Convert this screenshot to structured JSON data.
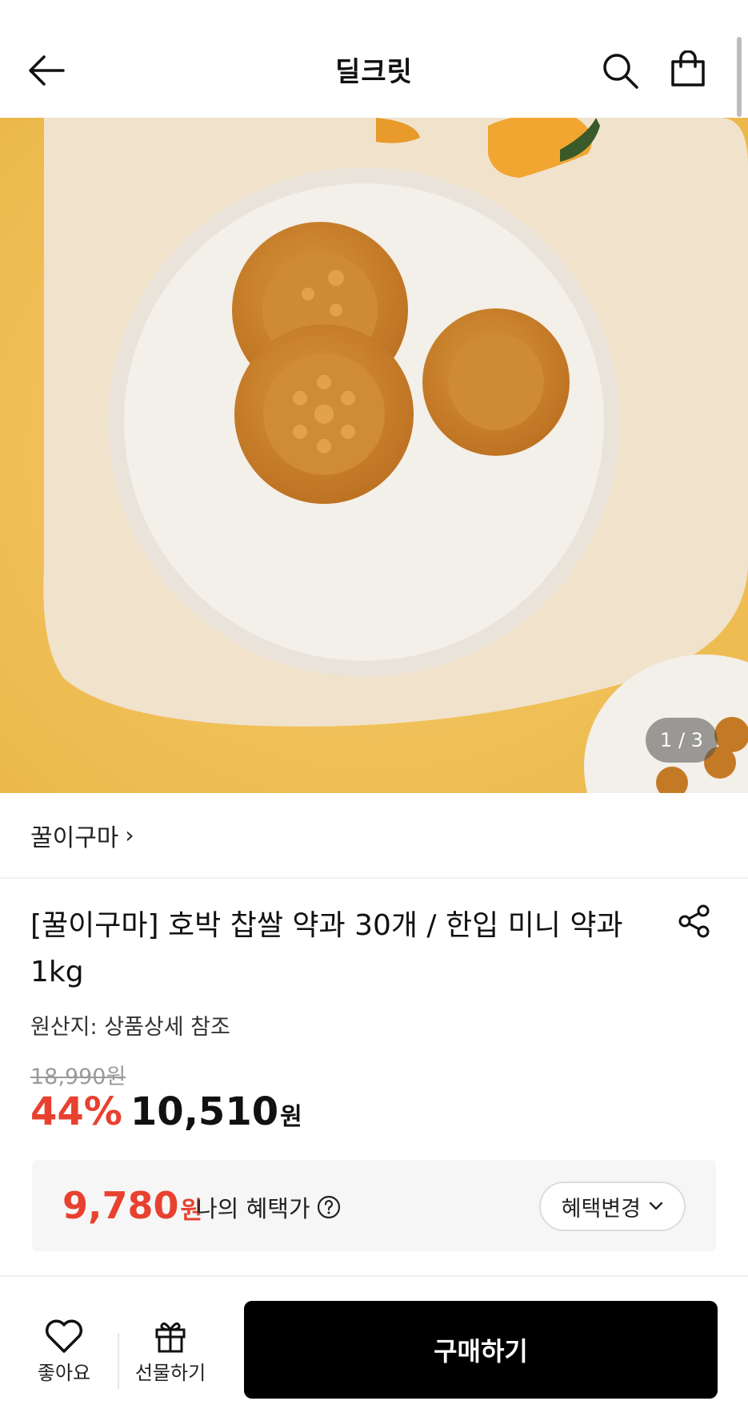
{
  "header": {
    "title": "딜크릿",
    "back_icon": "arrow-left-icon",
    "search_icon": "search-icon",
    "cart_icon": "shopping-bag-icon"
  },
  "hero": {
    "pager": "1 / 3"
  },
  "brand": {
    "name": "꿀이구마",
    "chevron": "›"
  },
  "product": {
    "title": "[꿀이구마] 호박 찹쌀 약과 30개 / 한입 미니 약과 1kg",
    "origin": "원산지: 상품상세 참조",
    "original_price": "18,990원",
    "discount": "44%",
    "sale_price": "10,510",
    "sale_unit": "원"
  },
  "benefit": {
    "amount": "9,780",
    "unit": "원",
    "label": "나의 혜택가",
    "change_label": "혜택변경"
  },
  "bottom_bar": {
    "like_label": "좋아요",
    "gift_label": "선물하기",
    "buy_label": "구매하기"
  },
  "colors": {
    "accent": "#e8412f",
    "buy_button": "#000000",
    "background": "#ffffff"
  }
}
